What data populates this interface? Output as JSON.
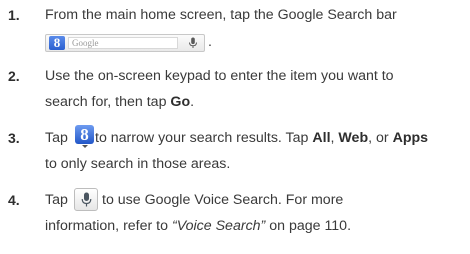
{
  "steps": [
    {
      "number": "1.",
      "text_before": "From the main home screen, tap the Google Search bar",
      "searchbar": {
        "logo": "8",
        "placeholder": "Google",
        "mic_icon": "microphone-icon"
      },
      "period": "."
    },
    {
      "number": "2.",
      "line1": "Use the on-screen keypad to enter the item you want to",
      "line2_before": "search for, then tap ",
      "line2_bold": "Go",
      "line2_after": "."
    },
    {
      "number": "3.",
      "before_icon": "Tap",
      "icon": "google-search-icon",
      "icon_glyph": "8",
      "after_icon": " to narrow your search results. Tap ",
      "all": "All",
      "comma1": ", ",
      "web": "Web",
      "or": ", or ",
      "apps": "Apps",
      "line2": "to only search in those areas."
    },
    {
      "number": "4.",
      "before_icon": "Tap",
      "icon": "microphone-icon",
      "after_icon": " to use Google Voice Search. For more",
      "line2_before": "information, refer to ",
      "line2_italic": "“Voice Search”",
      "line2_after": "  on page 110."
    }
  ]
}
